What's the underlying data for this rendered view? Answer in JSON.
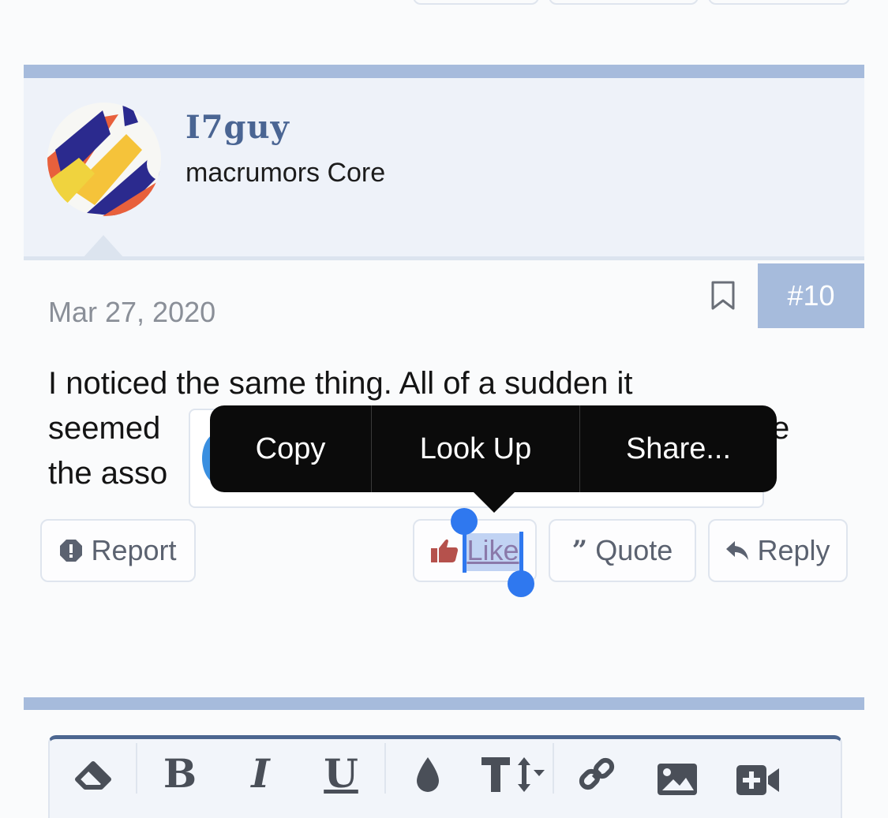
{
  "post": {
    "username": "I7guy",
    "user_title": "macrumors Core",
    "date": "Mar 27, 2020",
    "post_number": "#10",
    "body_lines": [
      "I noticed the same thing. All of a sudden it",
      "seemed",
      "the asso"
    ],
    "body_line3_tail": "e"
  },
  "actions": {
    "report": "Report",
    "like": "Like",
    "quote": "Quote",
    "reply": "Reply"
  },
  "context_menu": {
    "items": [
      "Copy",
      "Look Up",
      "Share..."
    ]
  },
  "editor_toolbar": {
    "icons": [
      "eraser-icon",
      "bold-icon",
      "italic-icon",
      "underline-icon",
      "color-drop-icon",
      "font-size-icon",
      "link-icon",
      "image-icon",
      "video-icon"
    ],
    "bold": "B",
    "italic": "I",
    "underline": "U"
  },
  "colors": {
    "accent": "#a6bbdc",
    "username": "#4a6593",
    "selection": "#2f78ef",
    "like_icon": "#b5514c"
  }
}
